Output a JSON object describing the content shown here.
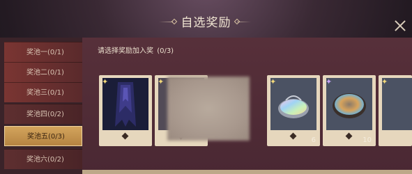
{
  "header": {
    "title": "自选奖励"
  },
  "sidebar": {
    "items": [
      {
        "label": "奖池一(0/1)"
      },
      {
        "label": "奖池二(0/1)"
      },
      {
        "label": "奖池三(0/1)"
      },
      {
        "label": "奖池四(0/2)"
      },
      {
        "label": "奖池五(0/3)"
      },
      {
        "label": "奖池六(0/2)"
      }
    ],
    "active_index": 4
  },
  "main": {
    "prompt": "请选择奖励加入奖",
    "prompt_count": "(0/3)",
    "cards": [
      {
        "icon": "dark-cloak-icon",
        "star": "gold"
      },
      {
        "icon": "star-icon",
        "star": "gold"
      },
      {
        "icon": "hidden-item-icon"
      },
      {
        "icon": "rainbow-orb-icon",
        "star": "gold",
        "quantity": "6"
      },
      {
        "icon": "rainbow-stone-icon",
        "star": "purple",
        "quantity": "10"
      },
      {
        "icon": "partial-card-icon",
        "star": "gold"
      }
    ]
  },
  "colors": {
    "accent_gold": "#d3a45c",
    "panel_bg": "#4a2833",
    "card_bg": "#e6d7bd"
  }
}
